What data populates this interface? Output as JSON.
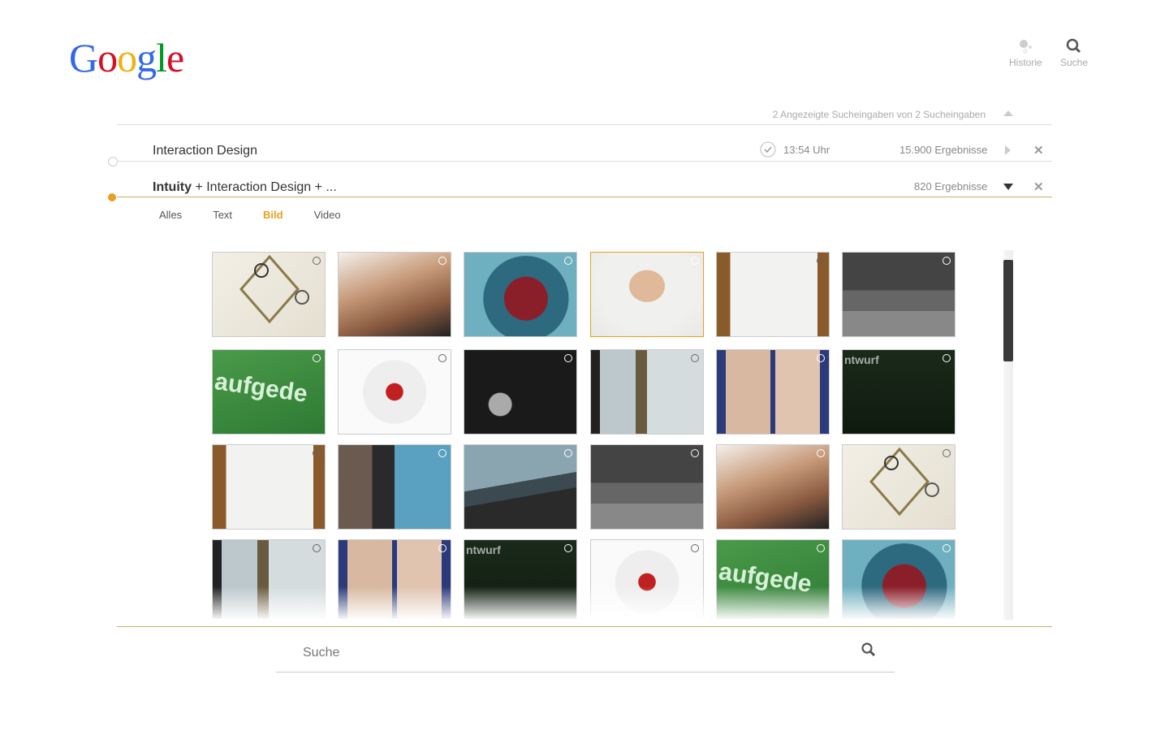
{
  "logo": {
    "letters": [
      "G",
      "o",
      "o",
      "g",
      "l",
      "e"
    ]
  },
  "nav": {
    "history_label": "Historie",
    "search_label": "Suche"
  },
  "summary": {
    "text": "2 Angezeigte  Sucheingaben von 2 Sucheingaben"
  },
  "queries": [
    {
      "title": "Interaction Design",
      "time": "13:54 Uhr",
      "results": "15.900 Ergebnisse"
    },
    {
      "title_bold": "Intuity",
      "title_rest": " + Interaction Design + ...",
      "results": "820 Ergebnisse"
    }
  ],
  "tabs": [
    "Alles",
    "Text",
    "Bild",
    "Video"
  ],
  "active_tab": "Bild",
  "colors": {
    "accent": "#e8a021"
  },
  "images": [
    "kinect-diamond-ui",
    "chocolate-pieces",
    "venn-circles",
    "portrait-man",
    "paper-pyramid",
    "dark-ui-kategorie",
    "green-aufgeder",
    "electronics-sphere",
    "dark-diagram",
    "architecture-interior",
    "two-men-portrait",
    "entwurf-diagram",
    "paper-pyramid",
    "presentation-speaker",
    "light-panel",
    "dark-ui-kategorie",
    "chocolate-pieces",
    "kinect-diamond-ui",
    "architecture-interior",
    "two-men-portrait",
    "entwurf-diagram",
    "electronics-sphere",
    "green-aufgeder",
    "venn-circles"
  ],
  "search": {
    "placeholder": "Suche"
  }
}
